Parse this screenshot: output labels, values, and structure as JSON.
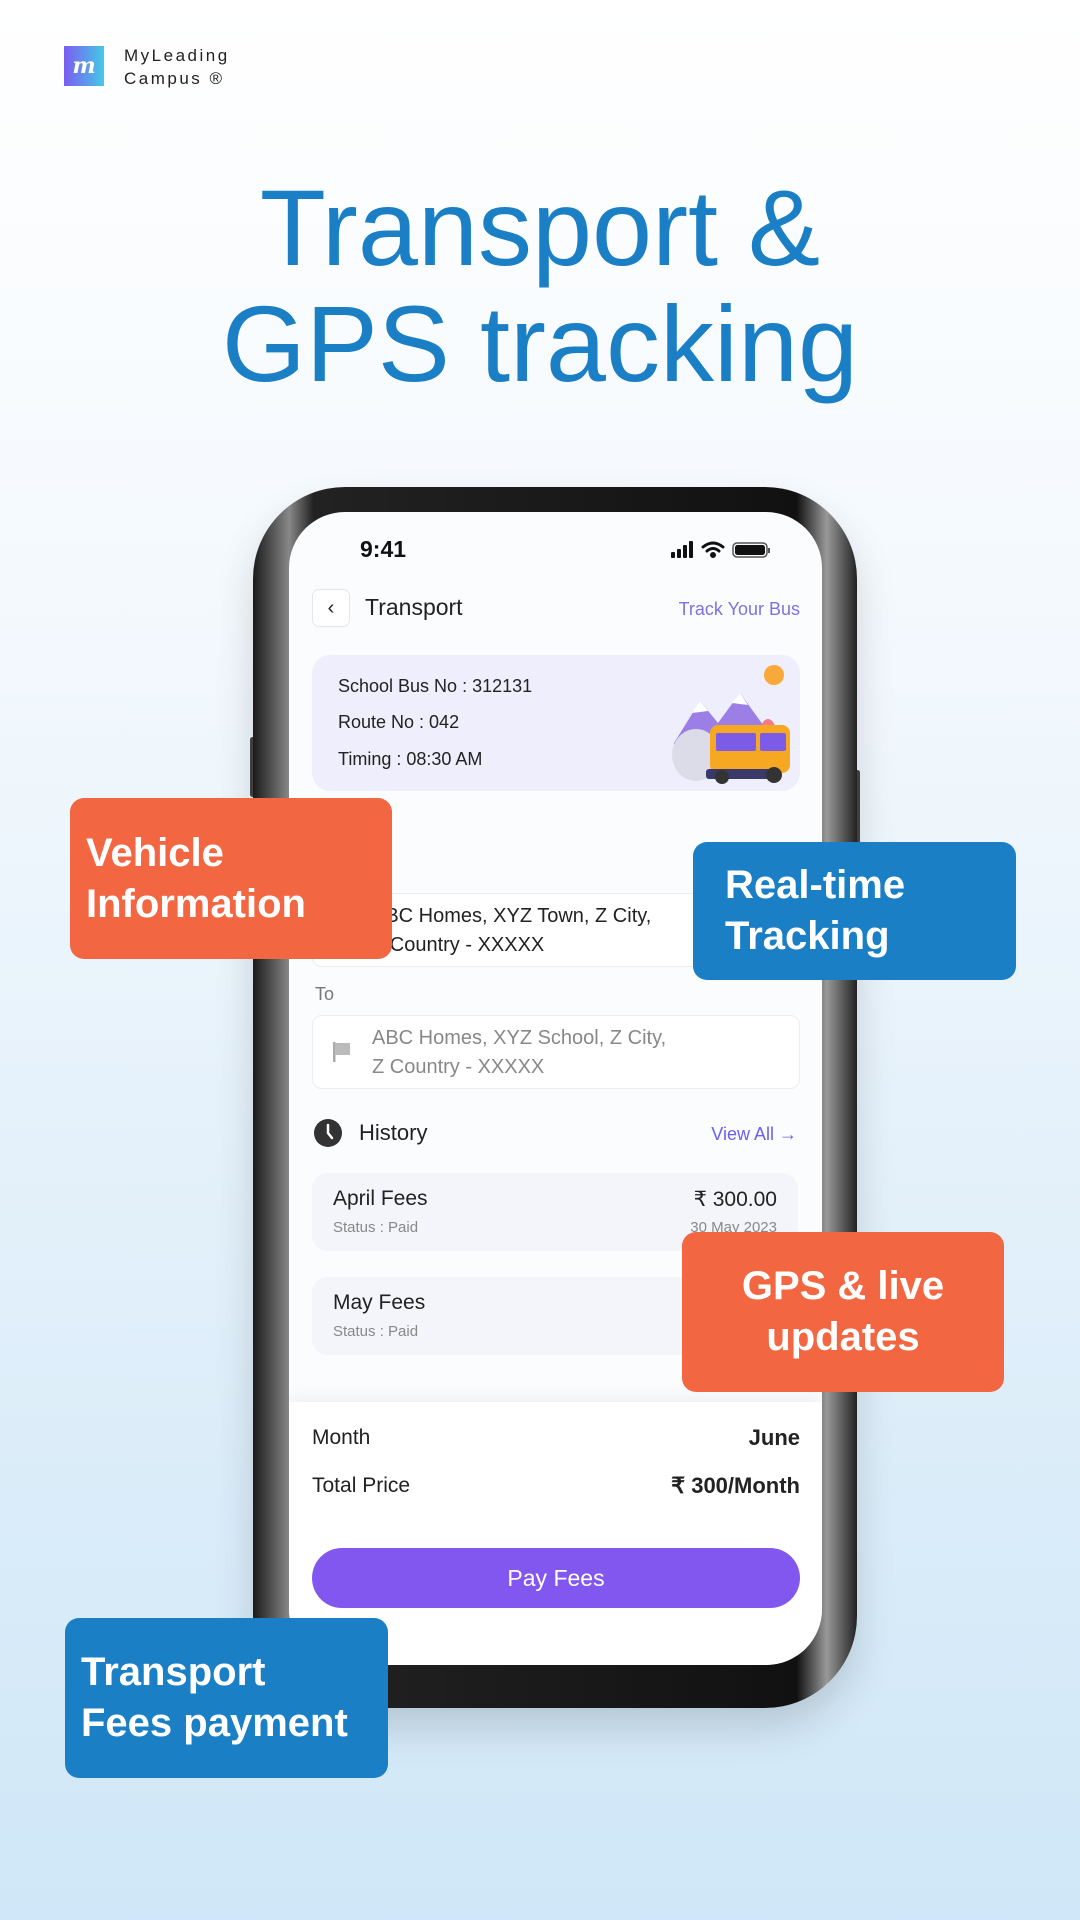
{
  "brand": {
    "logo_letter": "m",
    "name_line1": "MyLeading",
    "name_line2": "Campus ®"
  },
  "headline": {
    "line1": "Transport &",
    "line2": "GPS tracking"
  },
  "status_bar": {
    "time": "9:41"
  },
  "header": {
    "title": "Transport",
    "action": "Track Your Bus"
  },
  "bus_info": {
    "bus_no": "School Bus No : 312131",
    "route": "Route No : 042",
    "timing": "Timing : 08:30 AM"
  },
  "route": {
    "from_value": "ABC Homes, XYZ Town, Z City,",
    "from_value2": "Z Country - XXXXX",
    "to_label": "To",
    "to_value": "ABC Homes, XYZ School, Z City,",
    "to_value2": "Z Country - XXXXX"
  },
  "history": {
    "title": "History",
    "view_all": "View All →",
    "items": [
      {
        "title": "April Fees",
        "status": "Status : Paid",
        "price": "₹ 300.00",
        "date": "30 May 2023"
      },
      {
        "title": "May Fees",
        "status": "Status : Paid"
      }
    ]
  },
  "payment": {
    "month_label": "Month",
    "month_value": "June",
    "total_label": "Total Price",
    "total_value": "₹ 300/Month",
    "pay_button": "Pay Fees"
  },
  "badges": {
    "vehicle": [
      "Vehicle",
      "Information"
    ],
    "tracking": [
      "Real-time",
      "Tracking"
    ],
    "gps": [
      "GPS & live",
      "updates"
    ],
    "fees": [
      "Transport",
      "Fees payment"
    ]
  },
  "colors": {
    "blue": "#1a7fc4",
    "orange": "#f26641",
    "purple": "#8257f0"
  }
}
